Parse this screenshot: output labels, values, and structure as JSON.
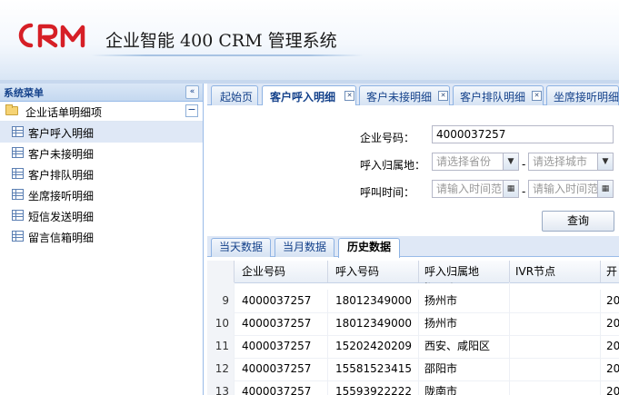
{
  "header": {
    "app_title": "企业智能 400 CRM 管理系统",
    "logo_text": "CRM"
  },
  "sidebar": {
    "title": "系统菜单",
    "collapse_icon": "double-chevron-left-icon",
    "group": {
      "label": "企业话单明细项",
      "icon": "folder-icon"
    },
    "items": [
      {
        "label": "客户呼入明细",
        "active": true
      },
      {
        "label": "客户未接明细"
      },
      {
        "label": "客户排队明细"
      },
      {
        "label": "坐席接听明细"
      },
      {
        "label": "短信发送明细"
      },
      {
        "label": "留言信箱明细"
      }
    ]
  },
  "tabs": [
    {
      "label": "起始页"
    },
    {
      "label": "客户呼入明细",
      "active": true
    },
    {
      "label": "客户未接明细"
    },
    {
      "label": "客户排队明细"
    },
    {
      "label": "坐席接听明细"
    }
  ],
  "form": {
    "company_label": "企业号码：",
    "company_value": "4000037257",
    "region_label": "呼入归属地：",
    "province_placeholder": "请选择省份",
    "city_placeholder": "请选择城市",
    "time_label": "呼叫时间：",
    "time_start_placeholder": "请输入时间范",
    "time_end_placeholder": "请输入时间范",
    "range_separator": "-",
    "query_button": "查询"
  },
  "subtabs": [
    {
      "label": "当天数据"
    },
    {
      "label": "当月数据"
    },
    {
      "label": "历史数据",
      "active": true
    }
  ],
  "grid": {
    "columns": [
      "企业号码",
      "呼入号码",
      "呼入归属地",
      "IVR节点",
      "开"
    ],
    "partial_row": {
      "company": "",
      "caller": "",
      "region": "扬州市"
    },
    "rows": [
      {
        "num": "9",
        "company": "4000037257",
        "caller": "18012349000",
        "region": "扬州市",
        "ivr": "",
        "start": "20"
      },
      {
        "num": "10",
        "company": "4000037257",
        "caller": "18012349000",
        "region": "扬州市",
        "ivr": "",
        "start": "20"
      },
      {
        "num": "11",
        "company": "4000037257",
        "caller": "15202420209",
        "region": "西安、咸阳区",
        "ivr": "",
        "start": "20"
      },
      {
        "num": "12",
        "company": "4000037257",
        "caller": "15581523415",
        "region": "邵阳市",
        "ivr": "",
        "start": "20"
      },
      {
        "num": "13",
        "company": "4000037257",
        "caller": "15593922222",
        "region": "陇南市",
        "ivr": "",
        "start": "20"
      }
    ]
  },
  "colors": {
    "brand_red": "#d61f26",
    "panel_border": "#99bbe8",
    "tab_text": "#15428b"
  }
}
